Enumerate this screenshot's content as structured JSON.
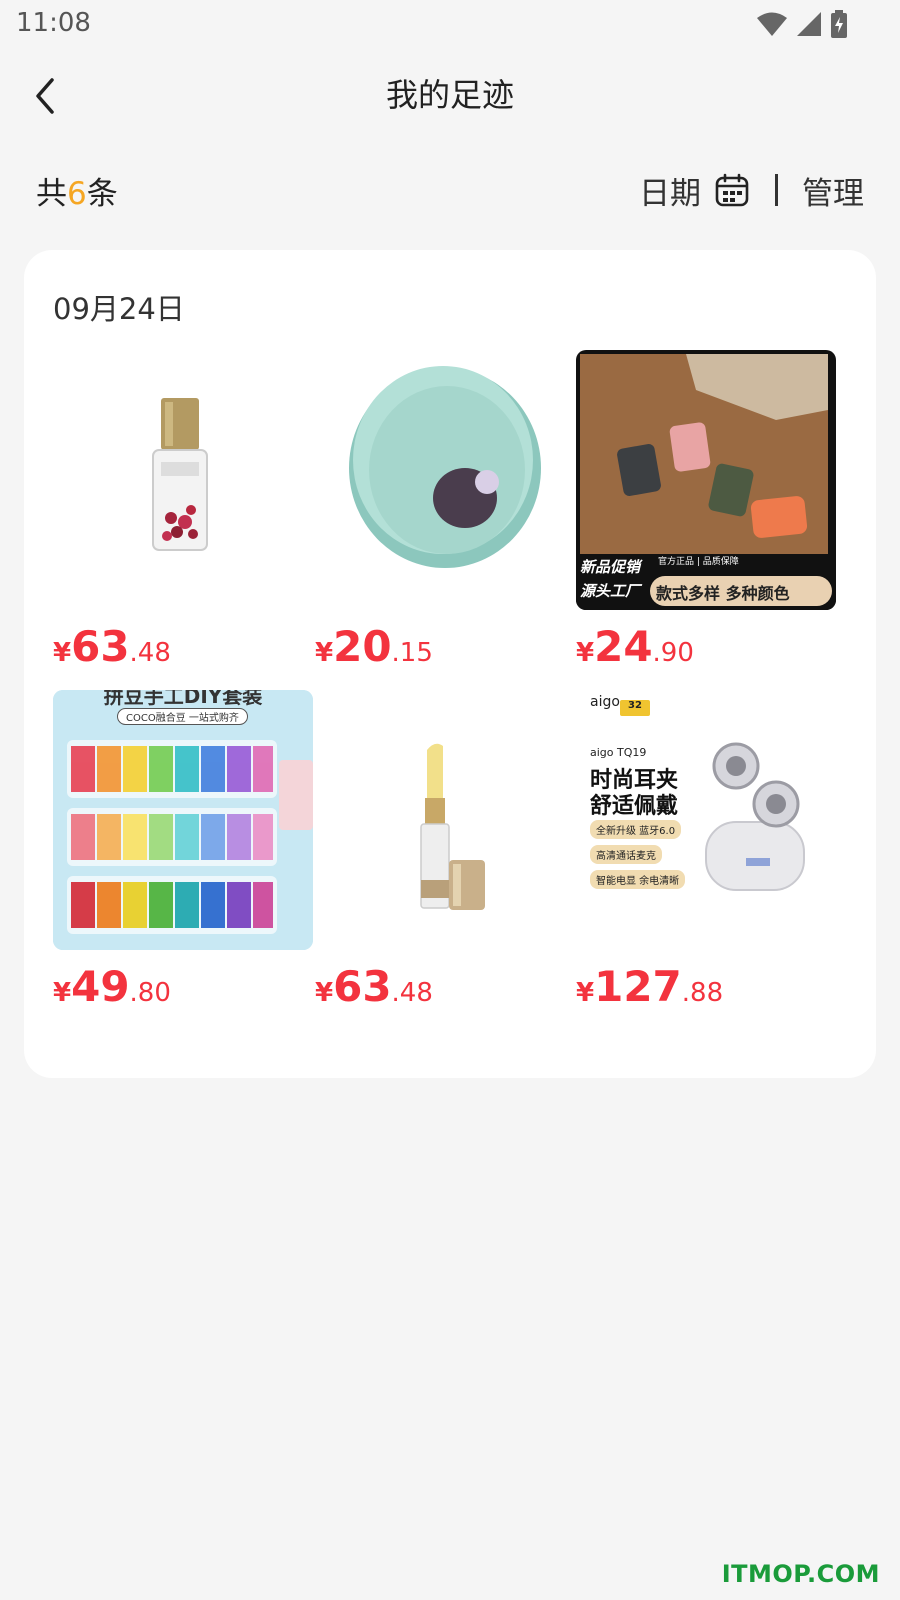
{
  "status": {
    "time": "11:08"
  },
  "header": {
    "title": "我的足迹"
  },
  "summary": {
    "prefix": "共",
    "count": "6",
    "suffix": "条",
    "date_label": "日期",
    "manage_label": "管理"
  },
  "group": {
    "date": "09月24日",
    "items": [
      {
        "symbol": "¥",
        "int": "63",
        "dec": ".48"
      },
      {
        "symbol": "¥",
        "int": "20",
        "dec": ".15"
      },
      {
        "symbol": "¥",
        "int": "24",
        "dec": ".90",
        "promo": {
          "top": "官方正品 | 品质保障",
          "left1": "新品促销",
          "left2": "源头工厂",
          "right": "款式多样  多种颜色"
        }
      },
      {
        "symbol": "¥",
        "int": "49",
        "dec": ".80",
        "banner": {
          "title": "拼豆手工DIY套装",
          "sub": "COCO融合豆 一站式购齐"
        }
      },
      {
        "symbol": "¥",
        "int": "63",
        "dec": ".48"
      },
      {
        "symbol": "¥",
        "int": "127",
        "dec": ".88",
        "ad": {
          "brand": "aigo",
          "model": "aigo TQ19",
          "line1": "时尚耳夹",
          "line2": "舒适佩戴",
          "tag1": "全新升级 蓝牙6.0",
          "tag2": "高清通话麦克",
          "tag3": "智能电显 余电清晰",
          "badge": "32"
        }
      }
    ]
  },
  "watermark": "ITMOP.COM",
  "colors": {
    "price": "#f3333e",
    "count": "#f5a623",
    "background": "#f5f5f5"
  }
}
